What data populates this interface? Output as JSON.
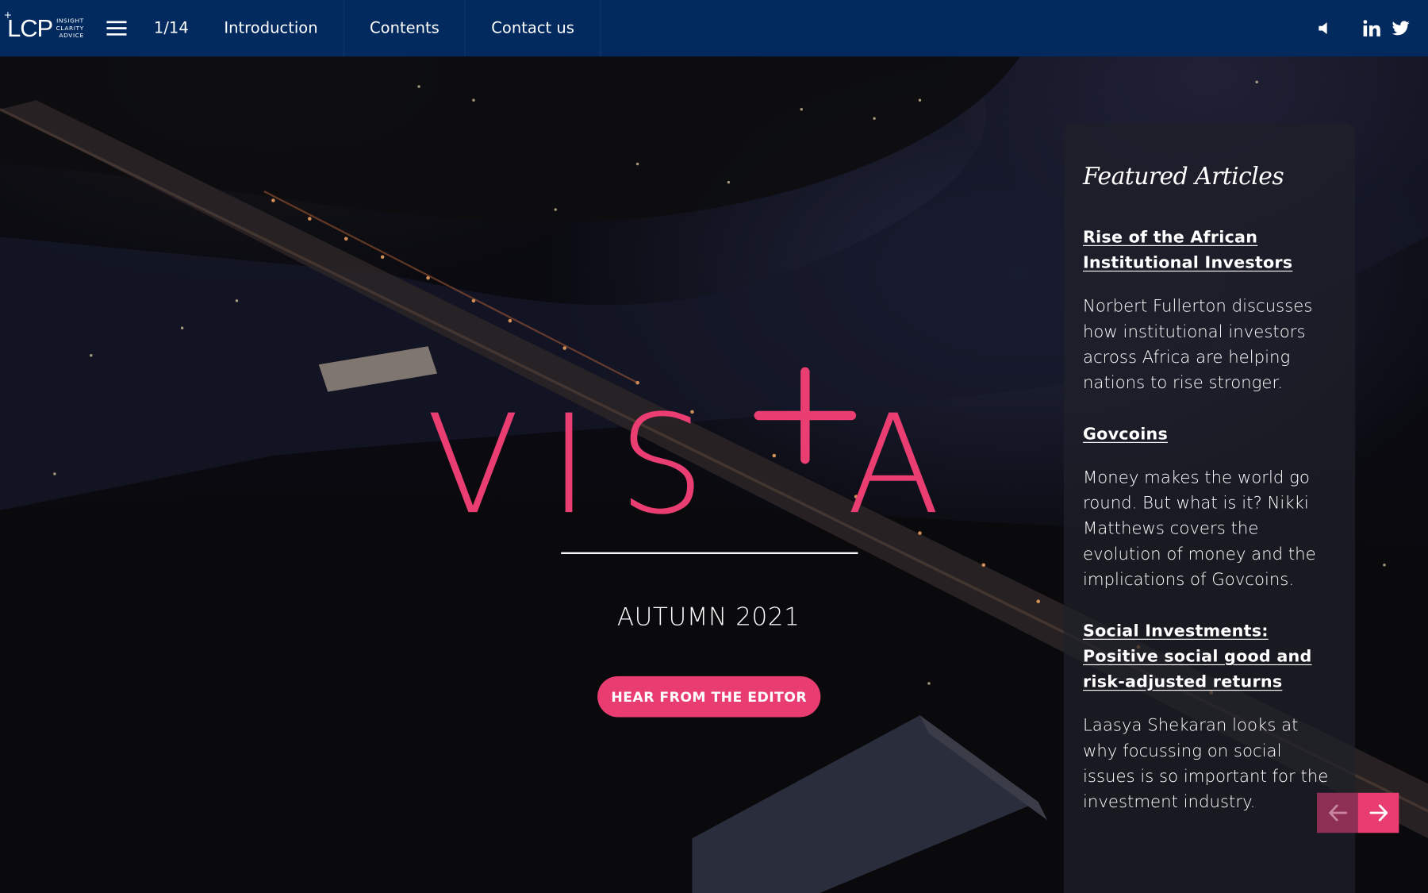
{
  "header": {
    "logo_mark": "LCP",
    "logo_tagline": [
      "INSIGHT",
      "CLARITY",
      "ADVICE"
    ],
    "page_counter": "1/14",
    "nav": [
      {
        "label": "Introduction"
      },
      {
        "label": "Contents"
      },
      {
        "label": "Contact us"
      }
    ],
    "icons": {
      "menu": "hamburger-menu-icon",
      "sound": "speaker-icon",
      "linkedin": "linkedin-icon",
      "twitter": "twitter-icon"
    }
  },
  "hero": {
    "title": "VISTA",
    "edition": "AUTUMN 2021",
    "cta_label": "HEAR FROM THE EDITOR"
  },
  "featured": {
    "heading": "Featured Articles",
    "articles": [
      {
        "title": "Rise of the African Institutional Investors",
        "description": "Norbert Fullerton discusses how institutional investors across Africa are helping nations to rise stronger."
      },
      {
        "title": "Govcoins",
        "description": "Money makes the world go round. But what is it? Nikki Matthews covers the evolution of money and the implications of Govcoins."
      },
      {
        "title": "Social Investments: Positive social good and risk-adjusted returns",
        "description": "Laasya Shekaran looks at why focussing on social issues is so important for the investment industry."
      }
    ]
  },
  "slider": {
    "prev_icon": "arrow-left-icon",
    "next_icon": "arrow-right-icon"
  },
  "colors": {
    "header_bg": "#022a5e",
    "accent": "#e93d72",
    "accent_dim": "#8e2f55",
    "text": "#ffffff"
  }
}
